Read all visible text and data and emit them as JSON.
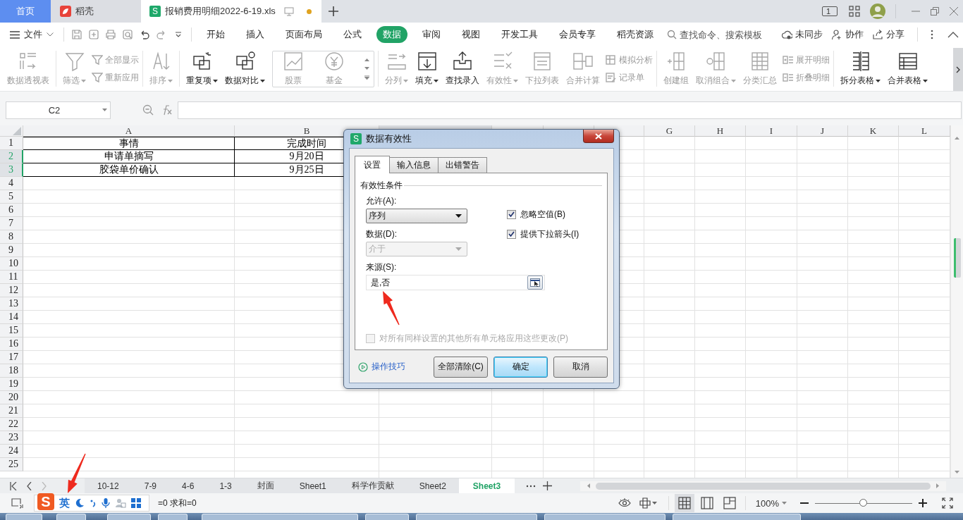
{
  "title_bar": {
    "tabs": [
      {
        "kind": "home",
        "label": "首页",
        "selected": false
      },
      {
        "kind": "docer",
        "label": "稻壳",
        "selected": false
      },
      {
        "kind": "sheet",
        "logo": "S",
        "label": "报销费用明细2022-6-19.xls",
        "selected": true,
        "unsaved": true
      }
    ],
    "page_badge": "1"
  },
  "menu_bar": {
    "file": "文件",
    "tabs": [
      {
        "label": "开始",
        "selected": false
      },
      {
        "label": "插入",
        "selected": false
      },
      {
        "label": "页面布局",
        "selected": false
      },
      {
        "label": "公式",
        "selected": false
      },
      {
        "label": "数据",
        "selected": true
      },
      {
        "label": "审阅",
        "selected": false
      },
      {
        "label": "视图",
        "selected": false
      },
      {
        "label": "开发工具",
        "selected": false
      },
      {
        "label": "会员专享",
        "selected": false
      },
      {
        "label": "稻壳资源",
        "selected": false
      }
    ],
    "search_placeholder": "查找命令、搜索模板",
    "actions": [
      "未同步",
      "协作",
      "分享"
    ]
  },
  "ribbon": {
    "groups": [
      {
        "items": [
          {
            "kind": "large",
            "label": "数据透视表",
            "disabled": true,
            "dropdown": false
          }
        ]
      },
      {
        "items": [
          {
            "kind": "large",
            "label": "筛选",
            "disabled": true,
            "dropdown": true
          },
          {
            "kind": "stack",
            "items": [
              {
                "label": "全部显示",
                "disabled": true
              },
              {
                "label": "重新应用",
                "disabled": true
              }
            ]
          }
        ]
      },
      {
        "items": [
          {
            "kind": "large",
            "label": "排序",
            "disabled": true,
            "dropdown": true
          }
        ]
      },
      {
        "items": [
          {
            "kind": "large",
            "label": "重复项",
            "disabled": false,
            "dropdown": true
          },
          {
            "kind": "large",
            "label": "数据对比",
            "disabled": false,
            "dropdown": true
          },
          {
            "kind": "gallery",
            "items": [
              {
                "label": "股票",
                "disabled": true
              },
              {
                "label": "基金",
                "disabled": true
              }
            ]
          }
        ]
      },
      {
        "items": [
          {
            "kind": "large",
            "label": "分列",
            "disabled": true,
            "dropdown": true
          },
          {
            "kind": "large",
            "label": "填充",
            "disabled": false,
            "dropdown": true
          },
          {
            "kind": "large",
            "label": "查找录入",
            "disabled": false,
            "dropdown": false
          },
          {
            "kind": "large",
            "label": "有效性",
            "disabled": true,
            "dropdown": true
          },
          {
            "kind": "large",
            "label": "下拉列表",
            "disabled": true,
            "dropdown": false
          },
          {
            "kind": "large",
            "label": "合并计算",
            "disabled": true,
            "dropdown": false
          },
          {
            "kind": "stack",
            "items": [
              {
                "label": "模拟分析",
                "disabled": true
              },
              {
                "label": "记录单",
                "disabled": true
              }
            ]
          }
        ]
      },
      {
        "items": [
          {
            "kind": "large",
            "label": "创建组",
            "disabled": true,
            "dropdown": false
          },
          {
            "kind": "large",
            "label": "取消组合",
            "disabled": true,
            "dropdown": true
          },
          {
            "kind": "large",
            "label": "分类汇总",
            "disabled": true,
            "dropdown": false
          },
          {
            "kind": "stack",
            "items": [
              {
                "label": "展开明细",
                "disabled": true
              },
              {
                "label": "折叠明细",
                "disabled": true
              }
            ]
          }
        ]
      },
      {
        "items": [
          {
            "kind": "large",
            "label": "拆分表格",
            "disabled": false,
            "dropdown": true
          },
          {
            "kind": "large",
            "label": "合并表格",
            "disabled": false,
            "dropdown": true
          }
        ]
      }
    ]
  },
  "formula_bar": {
    "name_box": "C2"
  },
  "sheet": {
    "columns": [
      {
        "label": "A",
        "selected": false
      },
      {
        "label": "B",
        "selected": false
      },
      {
        "selected": true
      },
      {
        "selected": false
      },
      {
        "selected": false
      },
      {
        "selected": false
      },
      {
        "label": "G",
        "selected": false
      },
      {
        "label": "H",
        "selected": false
      },
      {
        "label": "I",
        "selected": false
      },
      {
        "label": "J",
        "selected": false
      },
      {
        "label": "K",
        "selected": false
      },
      {
        "label": "L",
        "selected": false
      }
    ],
    "rows": [
      {
        "label": "1",
        "selected": false,
        "cells": [
          "事情",
          "完成时间"
        ]
      },
      {
        "label": "2",
        "selected": true,
        "cells": [
          "申请单摘写",
          "9月20日"
        ]
      },
      {
        "label": "3",
        "selected": true,
        "cells": [
          "胶袋单价确认",
          "9月25日"
        ]
      },
      {
        "label": "4",
        "selected": false
      },
      {
        "label": "5",
        "selected": false
      },
      {
        "label": "6",
        "selected": false
      },
      {
        "label": "7",
        "selected": false
      },
      {
        "label": "8",
        "selected": false
      },
      {
        "label": "9",
        "selected": false
      },
      {
        "label": "10",
        "selected": false
      },
      {
        "label": "11",
        "selected": false
      },
      {
        "label": "12",
        "selected": false
      },
      {
        "label": "13",
        "selected": false
      },
      {
        "label": "14",
        "selected": false
      },
      {
        "label": "15",
        "selected": false
      },
      {
        "label": "16",
        "selected": false
      },
      {
        "label": "17",
        "selected": false
      },
      {
        "label": "18",
        "selected": false
      },
      {
        "label": "19",
        "selected": false
      },
      {
        "label": "20",
        "selected": false
      },
      {
        "label": "21",
        "selected": false
      },
      {
        "label": "22",
        "selected": false
      },
      {
        "label": "23",
        "selected": false
      },
      {
        "label": "24",
        "selected": false
      },
      {
        "label": "25",
        "selected": false
      }
    ]
  },
  "dialog": {
    "logo": "S",
    "title": "数据有效性",
    "tabs": [
      {
        "label": "设置",
        "selected": true
      },
      {
        "label": "输入信息",
        "selected": false
      },
      {
        "label": "出错警告",
        "selected": false
      }
    ],
    "section": "有效性条件",
    "allow": {
      "label": "允许(A):",
      "value": "序列",
      "disabled": false
    },
    "data": {
      "label": "数据(D):",
      "value": "介于",
      "disabled": true
    },
    "options": [
      {
        "label": "忽略空值(B)",
        "checked": true,
        "disabled": false
      },
      {
        "label": "提供下拉箭头(I)",
        "checked": true,
        "disabled": false
      }
    ],
    "source": {
      "label": "来源(S):",
      "value": "是,否"
    },
    "apply_all": {
      "label": "对所有同样设置的其他所有单元格应用这些更改(P)",
      "checked": false,
      "disabled": true
    },
    "tips_link": "操作技巧",
    "buttons": [
      {
        "label": "全部清除(C)",
        "default": false
      },
      {
        "label": "确定",
        "default": true
      },
      {
        "label": "取消",
        "default": false
      }
    ]
  },
  "sheet_tabs": {
    "tabs": [
      {
        "label": "10-12",
        "selected": false
      },
      {
        "label": "7-9",
        "selected": false
      },
      {
        "label": "4-6",
        "selected": false
      },
      {
        "label": "1-3",
        "selected": false
      },
      {
        "label": "封面",
        "selected": false
      },
      {
        "label": "Sheet1",
        "selected": false
      },
      {
        "label": "科学作贡献",
        "selected": false
      },
      {
        "label": "Sheet2",
        "selected": false
      },
      {
        "label": "Sheet3",
        "selected": true
      }
    ]
  },
  "status_bar": {
    "summary": "=0 求和=0",
    "views": [
      {
        "kind": "normal",
        "selected": true
      },
      {
        "kind": "page-break",
        "selected": false
      },
      {
        "kind": "page-layout",
        "selected": false
      }
    ],
    "zoom": "100%",
    "zoom_slider": {
      "level": 0.5
    }
  },
  "ime_toolbar": {
    "logo": "S",
    "mode": "英"
  }
}
